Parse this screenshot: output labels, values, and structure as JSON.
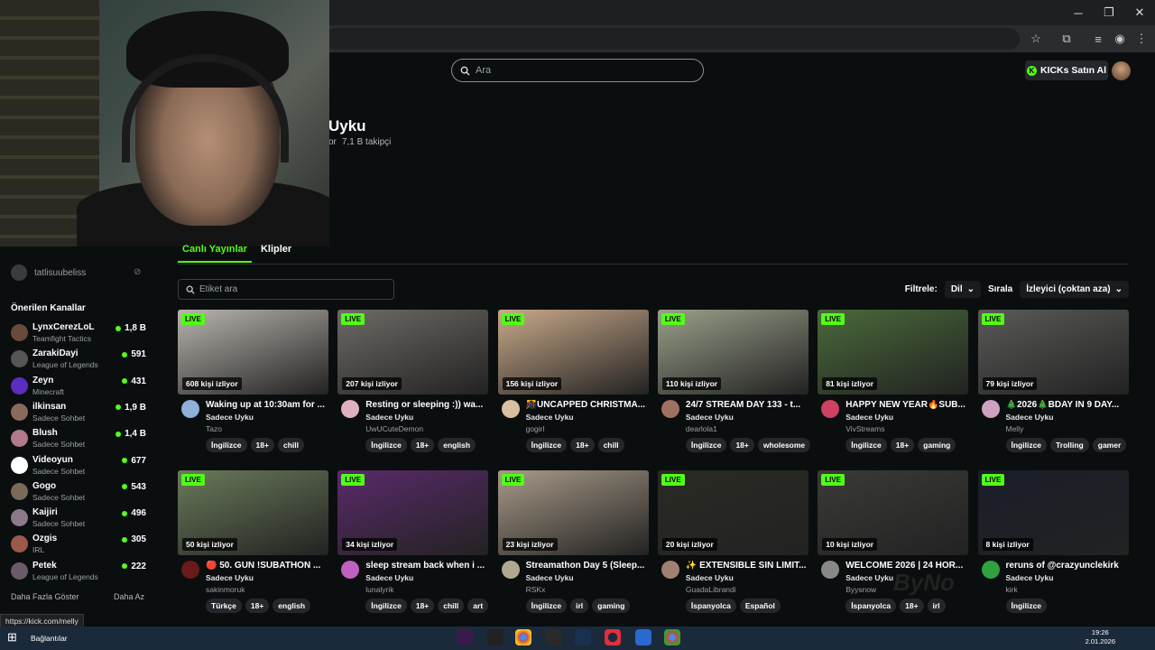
{
  "search": {
    "placeholder": "Ara"
  },
  "header": {
    "kicks_label": "KICKs Satın Al"
  },
  "channel": {
    "name": "Uyku",
    "followers_suffix": "or",
    "followers": "7,1 B takipçi"
  },
  "sidebar": {
    "followed_user": "tatlisuubeliss",
    "recommended_title": "Önerilen Kanallar",
    "channels": [
      {
        "name": "LynxCerezLoL",
        "game": "Teamfight Tactics",
        "viewers": "1,8 B",
        "color": "#6a4a3a"
      },
      {
        "name": "ZarakiDayi",
        "game": "League of Legends",
        "viewers": "591",
        "color": "#555"
      },
      {
        "name": "Zeyn",
        "game": "Minecraft",
        "viewers": "431",
        "color": "#5b2dbf"
      },
      {
        "name": "ilkinsan",
        "game": "Sadece Sohbet",
        "viewers": "1,9 B",
        "color": "#8a6a5a"
      },
      {
        "name": "Blush",
        "game": "Sadece Sohbet",
        "viewers": "1,4 B",
        "color": "#b07a8a"
      },
      {
        "name": "Videoyun",
        "game": "Sadece Sohbet",
        "viewers": "677",
        "color": "#ffffff"
      },
      {
        "name": "Gogo",
        "game": "Sadece Sohbet",
        "viewers": "543",
        "color": "#7a6a5a"
      },
      {
        "name": "Kaijiri",
        "game": "Sadece Sohbet",
        "viewers": "496",
        "color": "#8a7a8a"
      },
      {
        "name": "Ozgis",
        "game": "IRL",
        "viewers": "305",
        "color": "#9a5a4a"
      },
      {
        "name": "Petek",
        "game": "League of Legends",
        "viewers": "222",
        "color": "#6a5a6a"
      }
    ],
    "show_more": "Daha Fazla Göster",
    "show_less": "Daha Az"
  },
  "tabs": {
    "live": "Canlı Yayınlar",
    "clips": "Klipler"
  },
  "tag_search": {
    "placeholder": "Etiket ara"
  },
  "filters": {
    "filter_label": "Filtrele:",
    "filter_value": "Dil",
    "sort_label": "Sırala",
    "sort_value": "İzleyici (çoktan aza)"
  },
  "live_badge": "LIVE",
  "streams": [
    {
      "title": "Waking up at 10:30am for ...",
      "category": "Sadece Uyku",
      "streamer": "Tazo",
      "viewers": "608 kişi izliyor",
      "tags": [
        "İngilizce",
        "18+",
        "chill"
      ],
      "thumb": "#b9b4ae",
      "avatar": "#8fb0d8"
    },
    {
      "title": "Resting or sleeping :)) wa...",
      "category": "Sadece Uyku",
      "streamer": "UwUCuteDemon",
      "viewers": "207 kişi izliyor",
      "tags": [
        "İngilizce",
        "18+",
        "english"
      ],
      "thumb": "#6e6a66",
      "avatar": "#e0b0c0"
    },
    {
      "title": "🎊UNCAPPED CHRISTMA...",
      "category": "Sadece Uyku",
      "streamer": "gogirl",
      "viewers": "156 kişi izliyor",
      "tags": [
        "İngilizce",
        "18+",
        "chill"
      ],
      "thumb": "#c9a98a",
      "avatar": "#d8c0a0"
    },
    {
      "title": "24/7 STREAM DAY 133 - t...",
      "category": "Sadece Uyku",
      "streamer": "dearlola1",
      "viewers": "110 kişi izliyor",
      "tags": [
        "İngilizce",
        "18+",
        "wholesome"
      ],
      "thumb": "#9aa08a",
      "avatar": "#a07060"
    },
    {
      "title": "HAPPY NEW YEAR🔥SUB...",
      "category": "Sadece Uyku",
      "streamer": "VivStreams",
      "viewers": "81 kişi izliyor",
      "tags": [
        "İngilizce",
        "18+",
        "gaming"
      ],
      "thumb": "#4a6a3a",
      "avatar": "#d04060"
    },
    {
      "title": "🎄2026🎄BDAY IN 9 DAY...",
      "category": "Sadece Uyku",
      "streamer": "Melly",
      "viewers": "79 kişi izliyor",
      "tags": [
        "İngilizce",
        "Trolling",
        "gamer"
      ],
      "thumb": "#5a5a58",
      "avatar": "#d0a0c0"
    },
    {
      "title": "🔴 50. GÜN !SUBATHON ...",
      "category": "Sadece Uyku",
      "streamer": "sakinmoruk",
      "viewers": "50 kişi izliyor",
      "tags": [
        "Türkçe",
        "18+",
        "english"
      ],
      "thumb": "#6a7a5a",
      "avatar": "#6a1a1a"
    },
    {
      "title": "sleep stream back when i ...",
      "category": "Sadece Uyku",
      "streamer": "lunalyrik",
      "viewers": "34 kişi izliyor",
      "tags": [
        "İngilizce",
        "18+",
        "chill",
        "art"
      ],
      "thumb": "#5a2a6a",
      "avatar": "#c060c0"
    },
    {
      "title": "Streamathon Day 5 (Sleep...",
      "category": "Sadece Uyku",
      "streamer": "RSKx",
      "viewers": "23 kişi izliyor",
      "tags": [
        "İngilizce",
        "irl",
        "gaming"
      ],
      "thumb": "#a89a88",
      "avatar": "#b0a890"
    },
    {
      "title": "✨ EXTENSIBLE SIN LIMIT...",
      "category": "Sadece Uyku",
      "streamer": "GuadaLibrandi",
      "viewers": "20 kişi izliyor",
      "tags": [
        "İspanyolca",
        "Español"
      ],
      "thumb": "#2a2a24",
      "avatar": "#a08070"
    },
    {
      "title": "WELCOME 2026 | 24 HOR...",
      "category": "Sadece Uyku",
      "streamer": "Byysnow",
      "viewers": "10 kişi izliyor",
      "tags": [
        "İspanyolca",
        "18+",
        "irl"
      ],
      "thumb": "#3a3a38",
      "avatar": "#888888"
    },
    {
      "title": "reruns of @crazyunclekirk",
      "category": "Sadece Uyku",
      "streamer": "kirk",
      "viewers": "8 kişi izliyor",
      "tags": [
        "İngilizce"
      ],
      "thumb": "#1a1e2a",
      "avatar": "#30a040"
    }
  ],
  "status_url": "https://kick.com/melly",
  "taskbar": {
    "label": "Bağlantılar",
    "time": "19:26",
    "date": "2.01.2026"
  },
  "watermark": "ByNo"
}
